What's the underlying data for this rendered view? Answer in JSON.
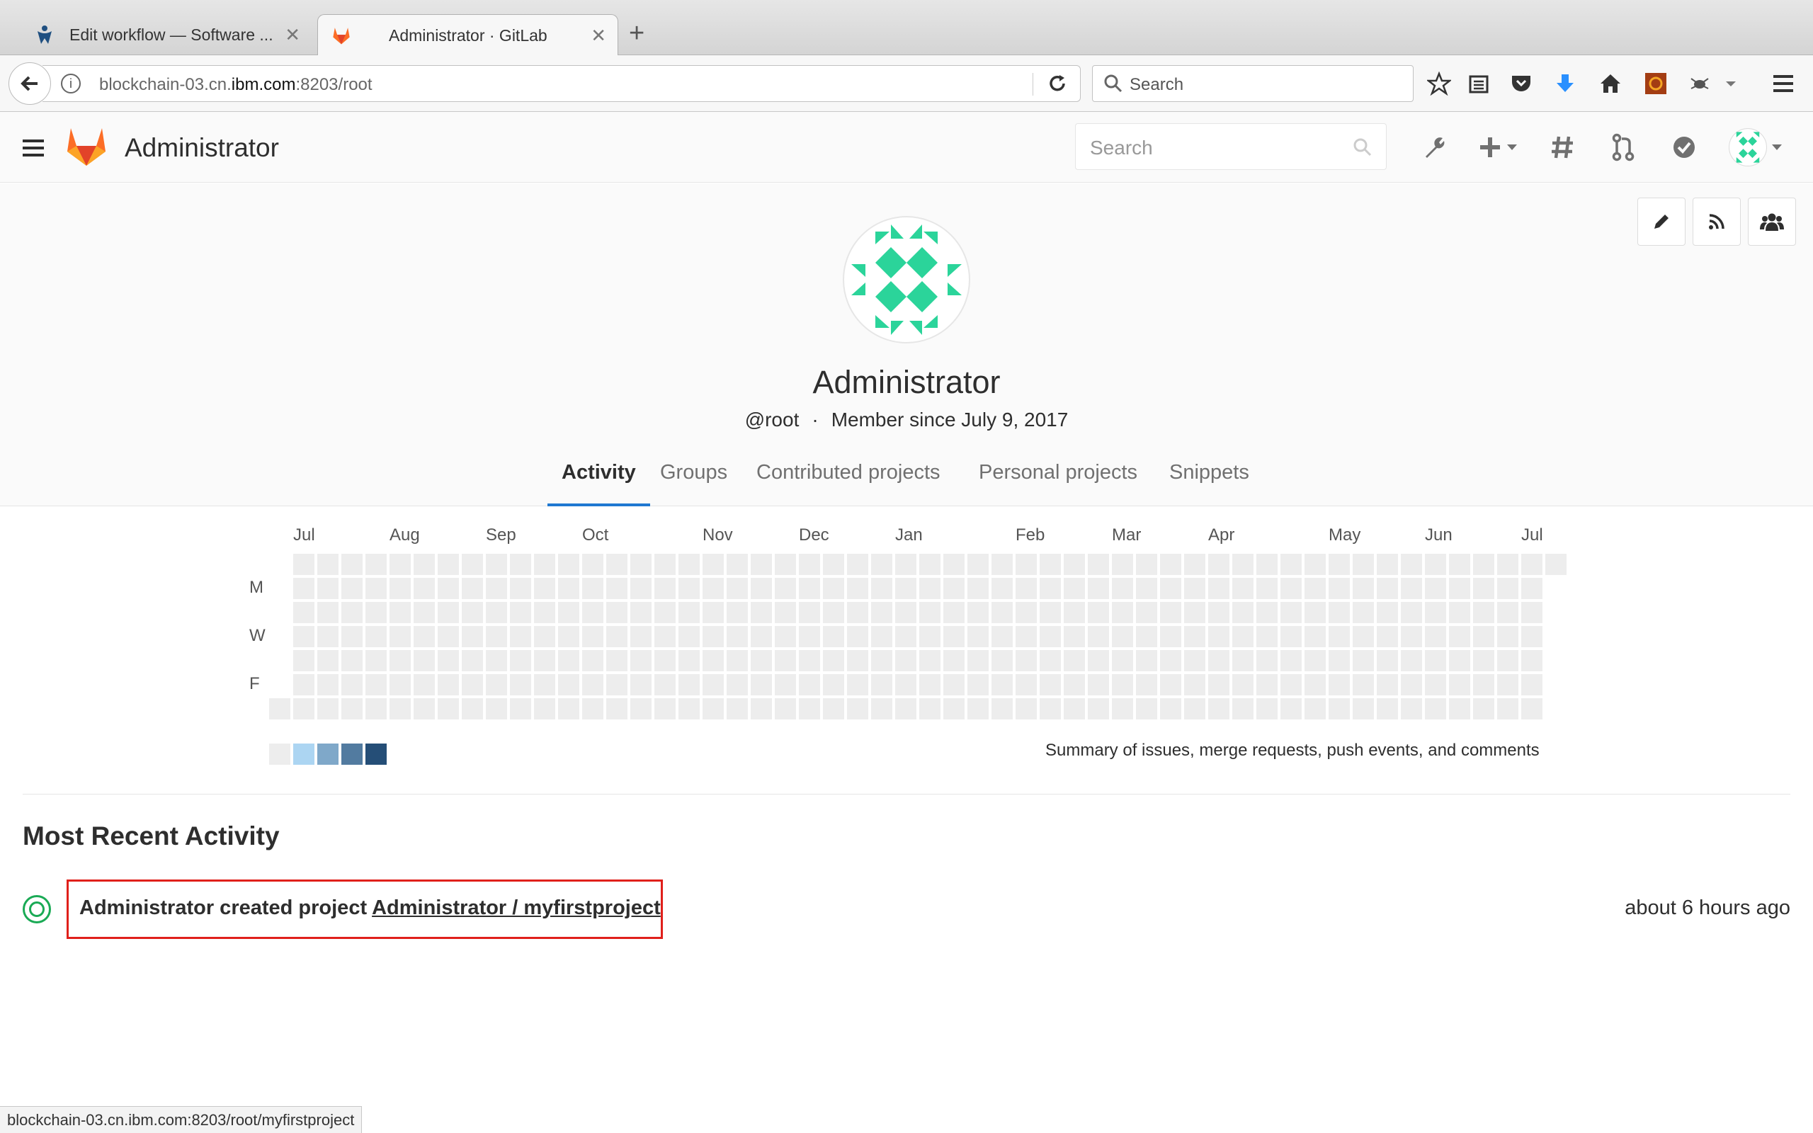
{
  "browser": {
    "tabs": [
      {
        "title": "Edit workflow — Software ...",
        "icon": "jira-icon",
        "active": false
      },
      {
        "title": "Administrator · GitLab",
        "icon": "gitlab-icon",
        "active": true
      }
    ],
    "url_prefix": "blockchain-03.cn.",
    "url_domain": "ibm.com",
    "url_suffix": ":8203/root",
    "search_placeholder": "Search",
    "status_url": "blockchain-03.cn.ibm.com:8203/root/myfirstproject"
  },
  "gitlab": {
    "header_title": "Administrator",
    "search_placeholder": "Search"
  },
  "profile": {
    "name": "Administrator",
    "username": "@root",
    "separator": "·",
    "member_since": "Member since July 9, 2017",
    "tabs": [
      "Activity",
      "Groups",
      "Contributed projects",
      "Personal projects",
      "Snippets"
    ],
    "active_tab": "Activity"
  },
  "calendar": {
    "months": [
      "Jul",
      "Aug",
      "Sep",
      "Oct",
      "Nov",
      "Dec",
      "Jan",
      "Feb",
      "Mar",
      "Apr",
      "May",
      "Jun",
      "Jul"
    ],
    "day_labels": [
      "M",
      "W",
      "F"
    ],
    "legend_colors": [
      "#ededed",
      "#acd5f2",
      "#7fa8c9",
      "#527ba0",
      "#254e77"
    ],
    "summary": "Summary of issues, merge requests, push events, and comments"
  },
  "activity": {
    "title": "Most Recent Activity",
    "events": [
      {
        "actor_action": "Administrator created project ",
        "target": "Administrator / myfirstproject",
        "time": "about 6 hours ago"
      }
    ]
  },
  "colors": {
    "gitlab_orange": "#fc6d26",
    "avatar_green": "#2bd49a",
    "link_blue": "#1f78d1",
    "highlight_red": "#e0201b"
  }
}
